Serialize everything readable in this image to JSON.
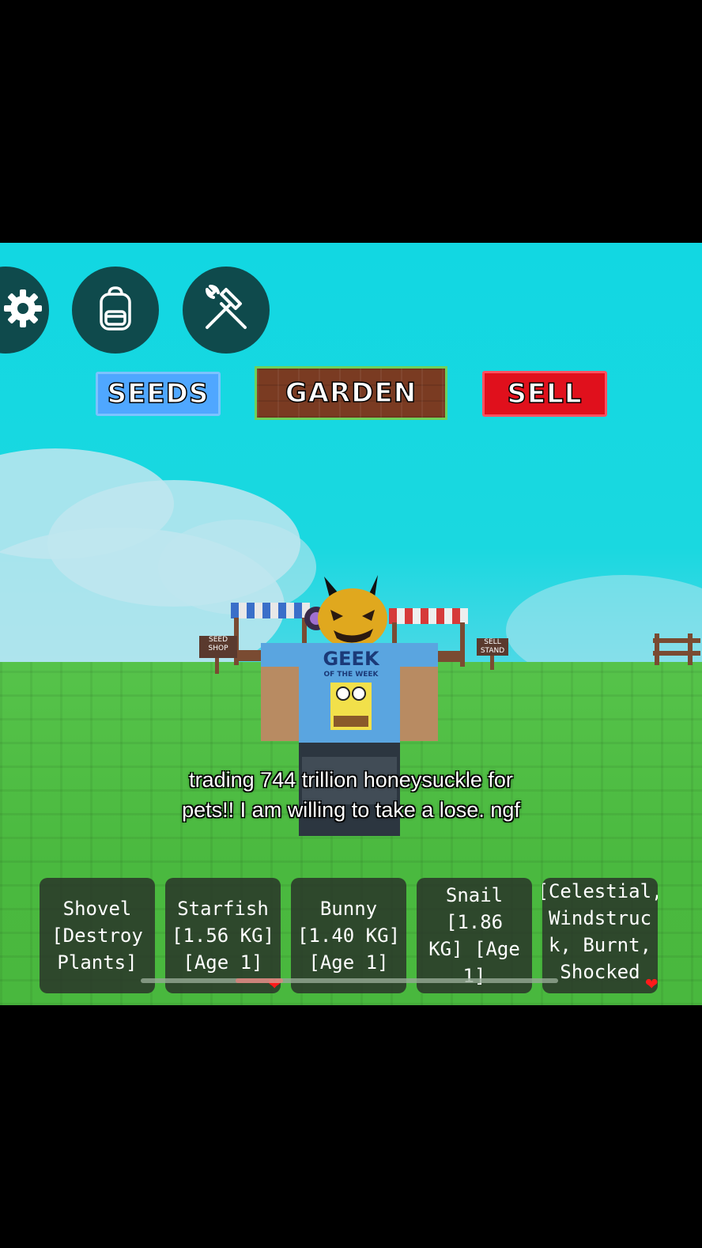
{
  "hud": {
    "icons": [
      "gear-icon",
      "backpack-icon",
      "tools-icon"
    ],
    "tabs": {
      "seeds": "SEEDS",
      "garden": "GARDEN",
      "sell": "SELL"
    }
  },
  "world": {
    "signs": {
      "seed_shop": "SEED\nSHOP",
      "sell_stand": "SELL\nSTAND"
    },
    "shirt_text": {
      "line1": "GEEK",
      "line2": "OF THE WEEK"
    }
  },
  "caption": "trading 744 trillion honeysuckle for\npets!! I am willing to take a lose. ngf",
  "hotbar": {
    "slots": [
      {
        "label": "Shovel\n[Destroy\nPlants]",
        "favorited": false
      },
      {
        "label": "Starfish\n[1.56 KG]\n[Age 1]",
        "favorited": true
      },
      {
        "label": "Bunny\n[1.40 KG]\n[Age 1]",
        "favorited": false
      },
      {
        "label": "Snail [1.86\nKG] [Age\n1]",
        "favorited": false
      },
      {
        "label": "[Celestial,\nWindstruc\nk, Burnt,\nShocked",
        "favorited": true
      }
    ]
  },
  "colors": {
    "sky": "#12d7e2",
    "grass": "#4ab93f",
    "hud_button": "#0f4a4c",
    "seeds": "#4fa7ff",
    "garden": "#7a3b22",
    "sell": "#e0101c",
    "favorite_heart": "#ff1a1a"
  }
}
